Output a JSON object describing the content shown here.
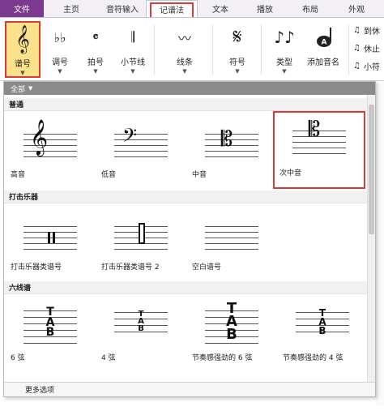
{
  "menu": {
    "file": "文件",
    "tabs": [
      "主页",
      "音符输入",
      "记谱法",
      "文本",
      "播放",
      "布局",
      "外观"
    ],
    "active_tab": "记谱法"
  },
  "ribbon": {
    "clef": "谱号",
    "key": "调号",
    "time": "拍号",
    "barline": "小节线",
    "lines": "线条",
    "symbols": "符号",
    "type": "类型",
    "add_note_name": "添加音名",
    "side": [
      "到休",
      "休止",
      "小符"
    ]
  },
  "gallery": {
    "filter": "全部",
    "sections": {
      "normal": "普通",
      "percussion": "打击乐器",
      "tab": "六线谱"
    },
    "normal_items": [
      "高音",
      "低音",
      "中音",
      "次中音"
    ],
    "percussion_items": [
      "打击乐器类谱号",
      "打击乐器类谱号 2",
      "空白谱号"
    ],
    "tab_items": [
      "6 弦",
      "4 弦",
      "节奏感强劲的 6 弦",
      "节奏感强劲的 4 弦"
    ],
    "more_options": "更多选项"
  },
  "colors": {
    "accent": "#7b3a8f",
    "highlight": "#d93a3a",
    "selected_bg": "#fbe28a"
  }
}
